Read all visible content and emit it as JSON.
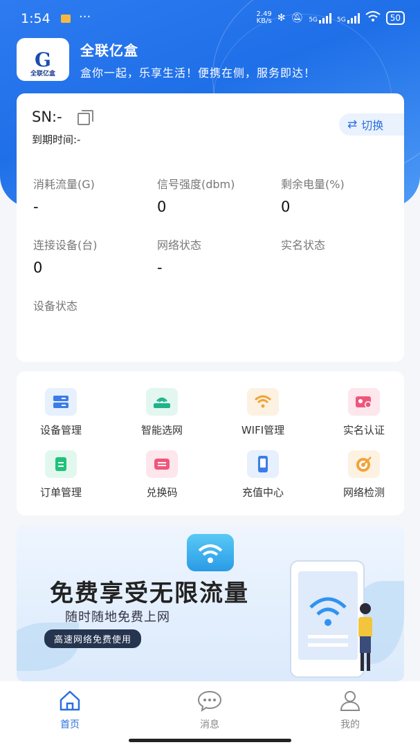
{
  "status_bar": {
    "time": "1:54",
    "dots": "···",
    "speed_value": "2.49",
    "speed_unit": "KB/s",
    "net1": "5G",
    "net2": "5G",
    "battery": "50",
    "icons": [
      "message-icon",
      "bluetooth-icon",
      "mute-icon",
      "signal-icon",
      "wifi-icon",
      "battery-icon"
    ]
  },
  "header": {
    "app_name": "全联亿盒",
    "slogan": "盒你一起，乐享生活！便携在侧，服务即达！",
    "logo_caption": "全联亿盒"
  },
  "device_card": {
    "sn": "SN:-",
    "expire": "到期时间:-",
    "switch_label": "切换",
    "stats": [
      {
        "label": "消耗流量(G)",
        "value": "-"
      },
      {
        "label": "信号强度(dbm)",
        "value": "0"
      },
      {
        "label": "剩余电量(%)",
        "value": "0"
      },
      {
        "label": "连接设备(台)",
        "value": "0"
      },
      {
        "label": "网络状态",
        "value": "-"
      },
      {
        "label": "实名状态",
        "value": ""
      },
      {
        "label": "设备状态",
        "value": ""
      }
    ]
  },
  "menu": [
    {
      "label": "设备管理",
      "icon": "device-manage-icon",
      "color": "#3b7de8",
      "bg": "#e7f0fd"
    },
    {
      "label": "智能选网",
      "icon": "router-icon",
      "color": "#1fb38a",
      "bg": "#e3f7f0"
    },
    {
      "label": "WIFI管理",
      "icon": "wifi-icon",
      "color": "#f2a33a",
      "bg": "#fdf2e2"
    },
    {
      "label": "实名认证",
      "icon": "id-card-icon",
      "color": "#f0567c",
      "bg": "#fde6ec"
    },
    {
      "label": "订单管理",
      "icon": "order-icon",
      "color": "#20c27a",
      "bg": "#e2f8ee"
    },
    {
      "label": "兑换码",
      "icon": "redeem-icon",
      "color": "#f0567c",
      "bg": "#fde6ec"
    },
    {
      "label": "充值中心",
      "icon": "recharge-icon",
      "color": "#3b7de8",
      "bg": "#e7f0fd"
    },
    {
      "label": "网络检测",
      "icon": "network-check-icon",
      "color": "#f2a33a",
      "bg": "#fdf2e2"
    }
  ],
  "banner": {
    "headline": "免费享受无限流量",
    "sub": "随时随地免费上网",
    "tag": "高速网络免费使用"
  },
  "tabs": [
    {
      "label": "首页",
      "icon": "home-icon",
      "active": true
    },
    {
      "label": "消息",
      "icon": "chat-icon",
      "active": false
    },
    {
      "label": "我的",
      "icon": "user-icon",
      "active": false
    }
  ],
  "colors": {
    "primary": "#2a6fe0",
    "hero": "#1f6fe8"
  }
}
